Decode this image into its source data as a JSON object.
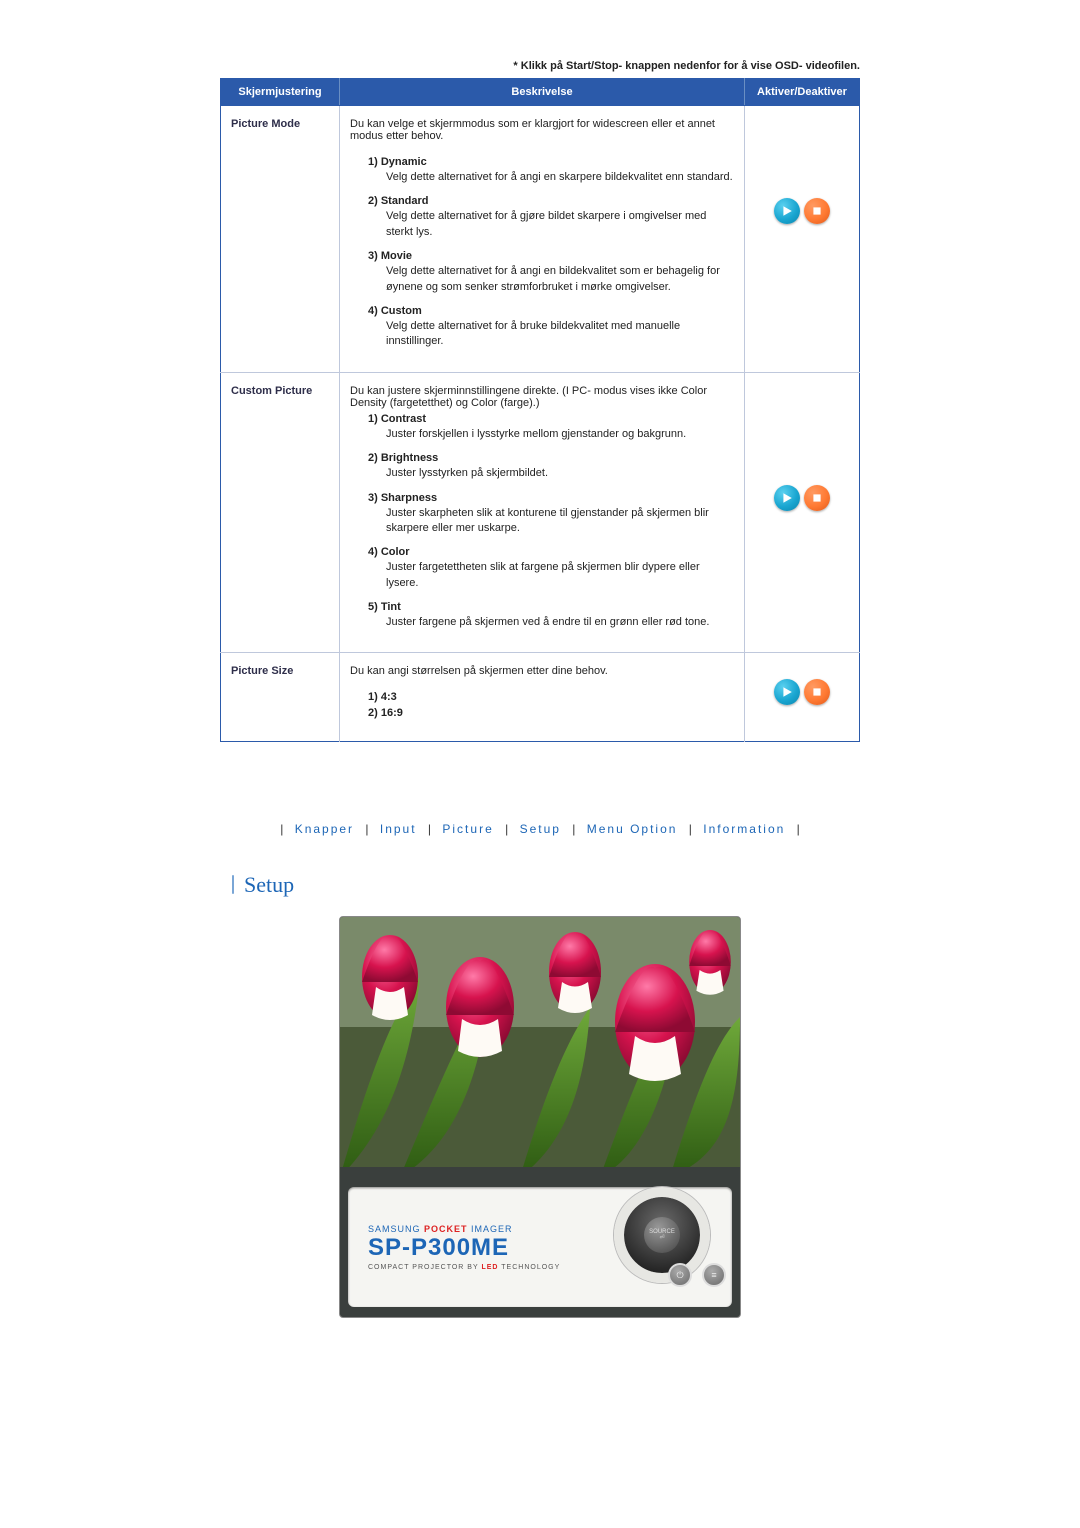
{
  "note": "* Klikk på Start/Stop- knappen nedenfor for å vise OSD- videofilen.",
  "headers": {
    "col1": "Skjermjustering",
    "col2": "Beskrivelse",
    "col3": "Aktiver/Deaktiver"
  },
  "rows": [
    {
      "name": "Picture Mode",
      "intro": "Du kan velge et skjermmodus som er klargjort for widescreen eller et annet modus etter behov.",
      "options": [
        {
          "title": "1) Dynamic",
          "desc": "Velg dette alternativet for å angi en skarpere bildekvalitet enn standard."
        },
        {
          "title": "2) Standard",
          "desc": "Velg dette alternativet for å gjøre bildet skarpere i omgivelser med sterkt lys."
        },
        {
          "title": "3) Movie",
          "desc": "Velg dette alternativet for å angi en bildekvalitet som er behagelig for øynene og som senker strømforbruket i mørke omgivelser."
        },
        {
          "title": "4) Custom",
          "desc": "Velg dette alternativet for å bruke bildekvalitet med manuelle innstillinger."
        }
      ]
    },
    {
      "name": "Custom Picture",
      "intro": "Du kan justere skjerminnstillingene direkte. (I PC- modus vises ikke Color Density (fargetetthet) og Color (farge).)",
      "options": [
        {
          "title": "1) Contrast",
          "desc": "Juster forskjellen i lysstyrke mellom gjenstander og bakgrunn."
        },
        {
          "title": "2) Brightness",
          "desc": "Juster lysstyrken på skjermbildet."
        },
        {
          "title": "3) Sharpness",
          "desc": "Juster skarpheten slik at konturene til gjenstander på skjermen blir skarpere eller mer uskarpe."
        },
        {
          "title": "4) Color",
          "desc": "Juster fargetettheten slik at fargene på skjermen blir dypere eller lysere."
        },
        {
          "title": "5) Tint",
          "desc": "Juster fargene på skjermen ved å endre til en grønn eller rød tone."
        }
      ]
    },
    {
      "name": "Picture Size",
      "intro": "Du kan angi størrelsen på skjermen etter dine behov.",
      "options": [
        {
          "title": "1) 4:3",
          "desc": ""
        },
        {
          "title": "2) 16:9",
          "desc": ""
        }
      ]
    }
  ],
  "footer_nav": {
    "items": [
      "Knapper",
      "Input",
      "Picture",
      "Setup",
      "Menu Option",
      "Information"
    ]
  },
  "section_title": "Setup",
  "device": {
    "brand_line1_a": "SAMSUNG ",
    "brand_line1_b": "POCKET",
    "brand_line1_c": " IMAGER",
    "model": "SP-P300ME",
    "tagline_a": "COMPACT PROJECTOR BY ",
    "tagline_b": "LED",
    "tagline_c": " TECHNOLOGY",
    "source_label": "SOURCE"
  }
}
